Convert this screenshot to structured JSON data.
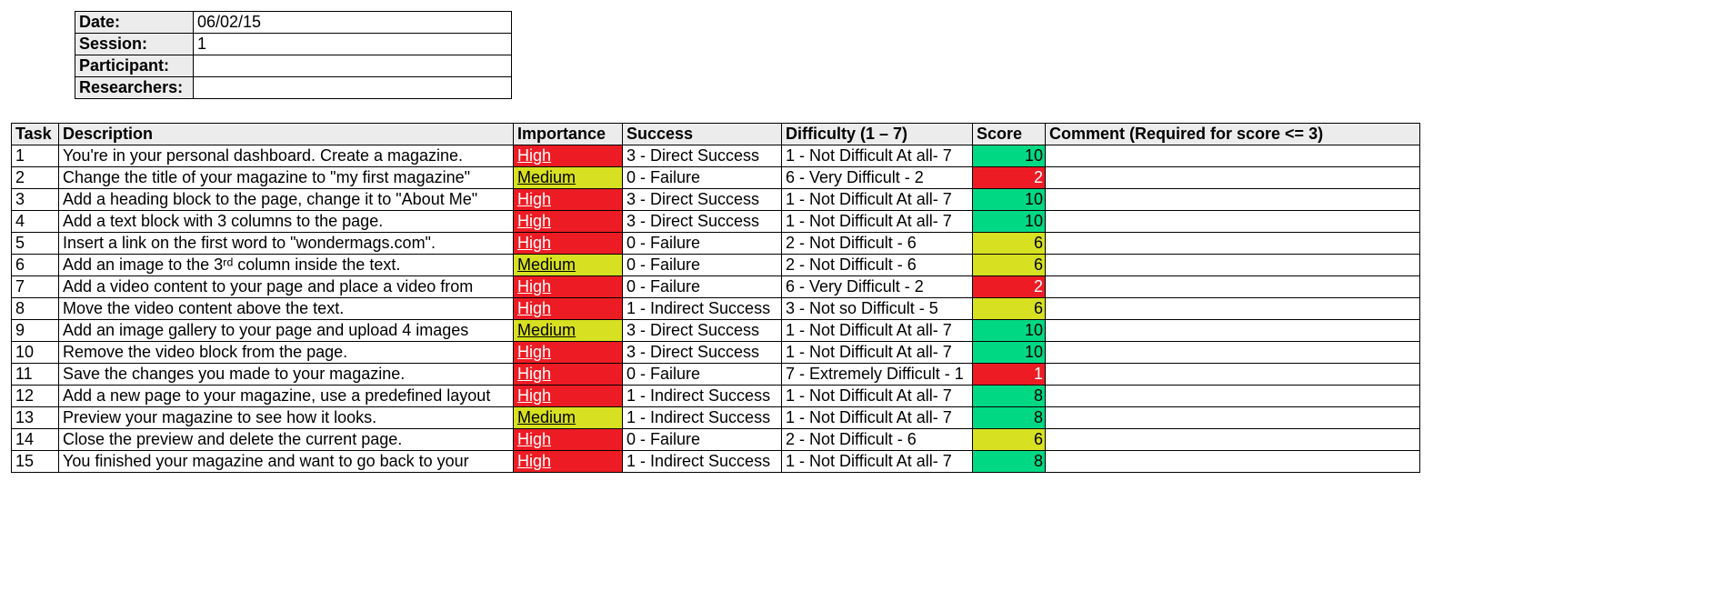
{
  "meta": {
    "date_label": "Date:",
    "date_value": "06/02/15",
    "session_label": "Session:",
    "session_value": "1",
    "participant_label": "Participant:",
    "participant_value": "",
    "researchers_label": "Researchers:",
    "researchers_value": ""
  },
  "headers": {
    "task": "Task",
    "description": "Description",
    "importance": "Importance",
    "success": "Success",
    "difficulty": "Difficulty (1 – 7)",
    "score": "Score",
    "comment": "Comment (Required for score <= 3)"
  },
  "rows": [
    {
      "task": "1",
      "desc": "You're in your personal dashboard. Create a magazine.",
      "imp": "High",
      "imp_class": "imp-high",
      "success": "3 - Direct Success",
      "diff": "1 - Not Difficult At all- 7",
      "score": "10",
      "score_class": "score-green",
      "comment": ""
    },
    {
      "task": "2",
      "desc": "Change the title of your magazine to \"my first magazine\"",
      "imp": "Medium",
      "imp_class": "imp-medium",
      "success": "0 - Failure",
      "diff": "6 - Very Difficult - 2",
      "score": "2",
      "score_class": "score-red",
      "comment": ""
    },
    {
      "task": "3",
      "desc": "Add a heading block to the page,  change it to \"About Me\"",
      "imp": "High",
      "imp_class": "imp-high",
      "success": "3 - Direct Success",
      "diff": "1 - Not Difficult At all- 7",
      "score": "10",
      "score_class": "score-green",
      "comment": ""
    },
    {
      "task": "4",
      "desc": "Add a text block with 3 columns to the page.",
      "imp": "High",
      "imp_class": "imp-high",
      "success": "3 - Direct Success",
      "diff": "1 - Not Difficult At all- 7",
      "score": "10",
      "score_class": "score-green",
      "comment": ""
    },
    {
      "task": "5",
      "desc": "Insert a link on the first word to \"wondermags.com\".",
      "imp": "High",
      "imp_class": "imp-high",
      "success": "0 - Failure",
      "diff": "2 - Not Difficult - 6",
      "score": "6",
      "score_class": "score-yellow",
      "comment": ""
    },
    {
      "task": "6",
      "desc": "Add an image to the 3ʳᵈ column inside the text.",
      "imp": "Medium",
      "imp_class": "imp-medium",
      "success": "0 - Failure",
      "diff": "2 - Not Difficult - 6",
      "score": "6",
      "score_class": "score-yellow",
      "comment": ""
    },
    {
      "task": "7",
      "desc": "Add a video content to your page and place a video from",
      "imp": "High",
      "imp_class": "imp-high",
      "success": "0 - Failure",
      "diff": "6 - Very Difficult - 2",
      "score": "2",
      "score_class": "score-red",
      "comment": ""
    },
    {
      "task": "8",
      "desc": "Move the video content above the text.",
      "imp": "High",
      "imp_class": "imp-high",
      "success": "1 - Indirect Success",
      "diff": "3 - Not so Difficult - 5",
      "score": "6",
      "score_class": "score-yellow",
      "comment": ""
    },
    {
      "task": "9",
      "desc": "Add an image gallery to your page and upload 4 images",
      "imp": "Medium",
      "imp_class": "imp-medium",
      "success": "3 - Direct Success",
      "diff": "1 - Not Difficult At all- 7",
      "score": "10",
      "score_class": "score-green",
      "comment": ""
    },
    {
      "task": "10",
      "desc": "Remove the video block from the page.",
      "imp": "High",
      "imp_class": "imp-high",
      "success": "3 - Direct Success",
      "diff": "1 - Not Difficult At all- 7",
      "score": "10",
      "score_class": "score-green",
      "comment": ""
    },
    {
      "task": "11",
      "desc": "Save the changes you made to your magazine.",
      "imp": "High",
      "imp_class": "imp-high",
      "success": "0 - Failure",
      "diff": "7 - Extremely Difficult - 1",
      "score": "1",
      "score_class": "score-red",
      "comment": ""
    },
    {
      "task": "12",
      "desc": "Add a new page to your magazine, use a predefined layout",
      "imp": "High",
      "imp_class": "imp-high",
      "success": "1 - Indirect Success",
      "diff": "1 - Not Difficult At all- 7",
      "score": "8",
      "score_class": "score-green",
      "comment": ""
    },
    {
      "task": "13",
      "desc": "Preview your magazine to see how it looks.",
      "imp": "Medium",
      "imp_class": "imp-medium",
      "success": "1 - Indirect Success",
      "diff": "1 - Not Difficult At all- 7",
      "score": "8",
      "score_class": "score-green",
      "comment": ""
    },
    {
      "task": "14",
      "desc": "Close the preview and delete the current page.",
      "imp": "High",
      "imp_class": "imp-high",
      "success": "0 - Failure",
      "diff": "2 - Not Difficult - 6",
      "score": "6",
      "score_class": "score-yellow",
      "comment": ""
    },
    {
      "task": "15",
      "desc": "You finished your magazine and want to go back to your",
      "imp": "High",
      "imp_class": "imp-high",
      "success": "1 - Indirect Success",
      "diff": "1 - Not Difficult At all- 7",
      "score": "8",
      "score_class": "score-green",
      "comment": ""
    }
  ]
}
